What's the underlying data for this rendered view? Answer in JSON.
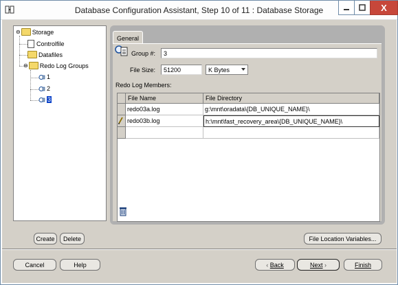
{
  "window": {
    "title": "Database Configuration Assistant, Step 10 of 11 : Database Storage",
    "close_symbol": "X"
  },
  "tree": {
    "root": "Storage",
    "items": [
      {
        "label": "Controlfile"
      },
      {
        "label": "Datafiles"
      },
      {
        "label": "Redo Log Groups"
      }
    ],
    "groups": [
      {
        "label": "1"
      },
      {
        "label": "2"
      },
      {
        "label": "3",
        "selected": true
      }
    ]
  },
  "tabs": [
    {
      "label": "General",
      "active": true
    }
  ],
  "form": {
    "group_label": "Group #:",
    "group_value": "3",
    "filesize_label": "File Size:",
    "filesize_value": "51200",
    "unit_value": "K Bytes",
    "members_label": "Redo Log Members:"
  },
  "members_table": {
    "columns": [
      "File Name",
      "File Directory"
    ],
    "rows": [
      {
        "file_name": "redo03a.log",
        "directory": "g:\\mnt\\oradata\\{DB_UNIQUE_NAME}\\"
      },
      {
        "file_name": "redo03b.log",
        "directory": "h:\\mnt\\fast_recovery_area\\{DB_UNIQUE_NAME}\\"
      },
      {
        "file_name": "",
        "directory": ""
      }
    ]
  },
  "buttons": {
    "create": "Create",
    "delete": "Delete",
    "file_location": "File Location Variables...",
    "cancel": "Cancel",
    "help": "Help",
    "back": "Back",
    "next": "Next",
    "finish": "Finish"
  },
  "colors": {
    "selection": "#0b42c9",
    "close_button": "#c7473a"
  }
}
